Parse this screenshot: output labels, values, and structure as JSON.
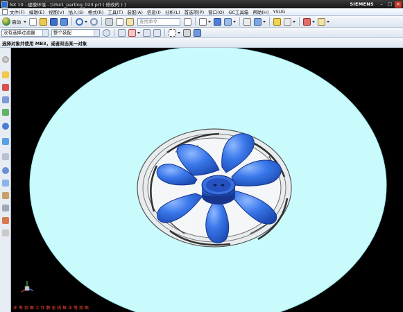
{
  "window": {
    "title": "NX 10 - 建模环境 - [U541_parting_023.prt ( 修改的 ) ]",
    "brand": "SIEMENS",
    "controls": [
      "–",
      "□",
      "×"
    ]
  },
  "menubar": {
    "items": [
      "文件(F)",
      "编辑(E)",
      "视图(V)",
      "插入(S)",
      "格式(R)",
      "工具(T)",
      "装配(A)",
      "信息(I)",
      "分析(L)",
      "首选项(P)",
      "窗口(O)",
      "GC工具箱",
      "帮助(H)",
      "YSUG"
    ]
  },
  "toolbar": {
    "start_label": "启动",
    "search_placeholder": "查找命令"
  },
  "selection_bar": {
    "filter_value": "没有选择过滤器",
    "scope_value": "整个装配"
  },
  "status": {
    "prompt": "选择对象并使用 MB3，或者双击某一对象",
    "bottom": "正 等 测 图 工 作  静 态 线 框 正 等 测 图"
  },
  "colors": {
    "background": "#000000",
    "disc": "#c9fbfd",
    "blade": "#2f6be0",
    "hub": "#1f4fc0",
    "frame": "#a9aeb8"
  },
  "icons": {
    "wcs": "coordinate-triad-icon"
  }
}
